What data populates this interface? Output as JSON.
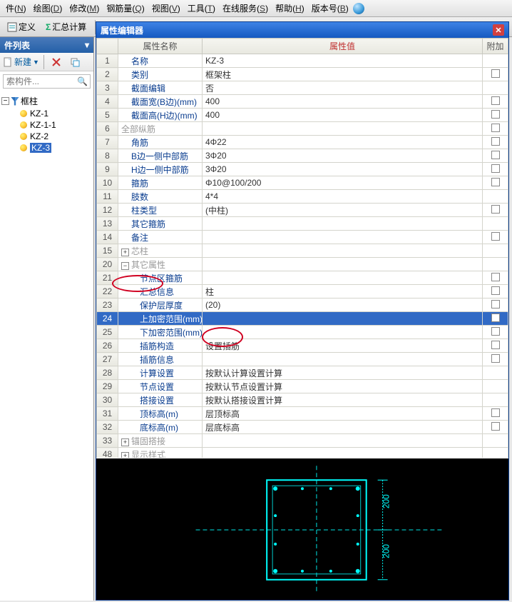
{
  "menu": [
    {
      "l": "件",
      "k": "N"
    },
    {
      "l": "绘图",
      "k": "D"
    },
    {
      "l": "修改",
      "k": "M"
    },
    {
      "l": "钢筋量",
      "k": "Q"
    },
    {
      "l": "视图",
      "k": "V"
    },
    {
      "l": "工具",
      "k": "T"
    },
    {
      "l": "在线服务",
      "k": "S"
    },
    {
      "l": "帮助",
      "k": "H"
    },
    {
      "l": "版本号",
      "k": "B"
    }
  ],
  "toolbar": {
    "define": "定义",
    "sum": "汇总计算"
  },
  "sidebar": {
    "title": "件列表",
    "new_label": "新建",
    "search_placeholder": "索构件...",
    "root": "框柱",
    "items": [
      "KZ-1",
      "KZ-1-1",
      "KZ-2",
      "KZ-3"
    ],
    "selected_index": 3
  },
  "editor_title": "属性编辑器",
  "columns": {
    "name": "属性名称",
    "value": "属性值",
    "extra": "附加"
  },
  "rows": [
    {
      "n": "1",
      "name": "名称",
      "val": "KZ-3",
      "chk": false,
      "link": true
    },
    {
      "n": "2",
      "name": "类别",
      "val": "框架柱",
      "chk": true,
      "link": true
    },
    {
      "n": "3",
      "name": "截面编辑",
      "val": "否",
      "chk": false,
      "link": true
    },
    {
      "n": "4",
      "name": "截面宽(B边)(mm)",
      "val": "400",
      "chk": true,
      "link": true
    },
    {
      "n": "5",
      "name": "截面高(H边)(mm)",
      "val": "400",
      "chk": true,
      "link": true
    },
    {
      "n": "6",
      "name": "全部纵筋",
      "val": "",
      "chk": true,
      "gray": true
    },
    {
      "n": "7",
      "name": "角筋",
      "val": "4Φ22",
      "chk": true,
      "link": true
    },
    {
      "n": "8",
      "name": "B边一侧中部筋",
      "val": "3Φ20",
      "chk": true,
      "link": true
    },
    {
      "n": "9",
      "name": "H边一侧中部筋",
      "val": "3Φ20",
      "chk": true,
      "link": true
    },
    {
      "n": "10",
      "name": "箍筋",
      "val": "Φ10@100/200",
      "chk": true,
      "link": true
    },
    {
      "n": "11",
      "name": "肢数",
      "val": "4*4",
      "chk": false,
      "link": true
    },
    {
      "n": "12",
      "name": "柱类型",
      "val": "(中柱)",
      "chk": true,
      "link": true
    },
    {
      "n": "13",
      "name": "其它箍筋",
      "val": "",
      "chk": false,
      "link": true
    },
    {
      "n": "14",
      "name": "备注",
      "val": "",
      "chk": true,
      "link": true
    },
    {
      "n": "15",
      "name": "芯柱",
      "val": "",
      "chk": false,
      "gray": true,
      "expand": "+"
    },
    {
      "n": "20",
      "name": "其它属性",
      "val": "",
      "chk": false,
      "gray": true,
      "expand": "−"
    },
    {
      "n": "21",
      "name": "节点区箍筋",
      "val": "",
      "chk": true,
      "link": true,
      "indent": 2
    },
    {
      "n": "22",
      "name": "汇总信息",
      "val": "柱",
      "chk": true,
      "link": true,
      "indent": 2
    },
    {
      "n": "23",
      "name": "保护层厚度",
      "val": "(20)",
      "chk": true,
      "link": true,
      "indent": 2
    },
    {
      "n": "24",
      "name": "上加密范围(mm)",
      "val": "",
      "chk": true,
      "link": true,
      "indent": 2,
      "selected": true
    },
    {
      "n": "25",
      "name": "下加密范围(mm)",
      "val": "",
      "chk": true,
      "link": true,
      "indent": 2
    },
    {
      "n": "26",
      "name": "插筋构造",
      "val": "设置插筋",
      "chk": true,
      "link": true,
      "indent": 2
    },
    {
      "n": "27",
      "name": "插筋信息",
      "val": "",
      "chk": true,
      "link": true,
      "indent": 2
    },
    {
      "n": "28",
      "name": "计算设置",
      "val": "按默认计算设置计算",
      "chk": false,
      "link": true,
      "indent": 2
    },
    {
      "n": "29",
      "name": "节点设置",
      "val": "按默认节点设置计算",
      "chk": false,
      "link": true,
      "indent": 2
    },
    {
      "n": "30",
      "name": "搭接设置",
      "val": "按默认搭接设置计算",
      "chk": false,
      "link": true,
      "indent": 2
    },
    {
      "n": "31",
      "name": "顶标高(m)",
      "val": "层顶标高",
      "chk": true,
      "link": true,
      "indent": 2
    },
    {
      "n": "32",
      "name": "底标高(m)",
      "val": "层底标高",
      "chk": true,
      "link": true,
      "indent": 2
    },
    {
      "n": "33",
      "name": "锚固搭接",
      "val": "",
      "chk": false,
      "gray": true,
      "expand": "+"
    },
    {
      "n": "48",
      "name": "显示样式",
      "val": "",
      "chk": false,
      "gray": true,
      "expand": "+"
    }
  ],
  "chart_data": {
    "type": "section",
    "width_mm": 400,
    "height_mm": 400,
    "dim_labels": [
      "200",
      "200"
    ],
    "rebar": {
      "corner": "4Φ22",
      "side_b": "3Φ20",
      "side_h": "3Φ20",
      "stirrup": "Φ10@100/200",
      "legs": "4*4"
    }
  }
}
